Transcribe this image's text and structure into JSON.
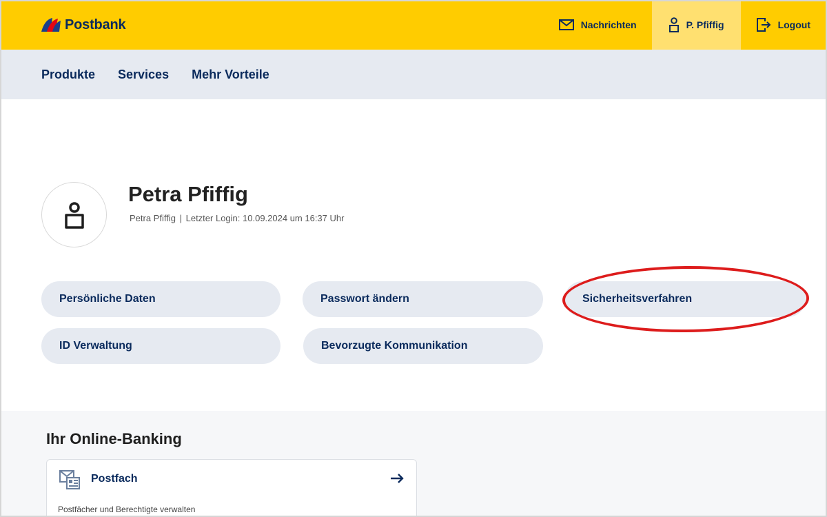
{
  "header": {
    "brand": "Postbank",
    "actions": [
      {
        "label": "Nachrichten",
        "icon": "envelope-icon"
      },
      {
        "label": "P. Pfiffig",
        "icon": "user-icon",
        "active": true
      },
      {
        "label": "Logout",
        "icon": "logout-icon"
      }
    ]
  },
  "nav": {
    "items": [
      {
        "label": "Produkte"
      },
      {
        "label": "Services"
      },
      {
        "label": "Mehr Vorteile"
      }
    ]
  },
  "profile": {
    "name": "Petra Pfiffig",
    "meta_name": "Petra Pfiffig",
    "meta_separator": "|",
    "last_login_label": "Letzter Login:",
    "last_login_value": "10.09.2024 um 16:37 Uhr",
    "avatar_icon": "user-avatar-icon"
  },
  "actions": {
    "personal_data": "Persönliche Daten",
    "change_password": "Passwort ändern",
    "security_procedures": "Sicherheitsverfahren",
    "id_management": "ID Verwaltung",
    "preferred_communication": "Bevorzugte Kommunikation"
  },
  "online_banking": {
    "title": "Ihr Online-Banking",
    "cards": [
      {
        "title": "Postfach",
        "description": "Postfächer und Berechtigte verwalten",
        "icon": "mailbox-icon",
        "arrow_icon": "arrow-right-icon"
      }
    ]
  },
  "colors": {
    "brand_yellow": "#ffcc00",
    "active_tab": "#ffe070",
    "nav_bg": "#e6eaf1",
    "text_navy": "#0a2a5c",
    "highlight_red": "#dd1c1c"
  }
}
